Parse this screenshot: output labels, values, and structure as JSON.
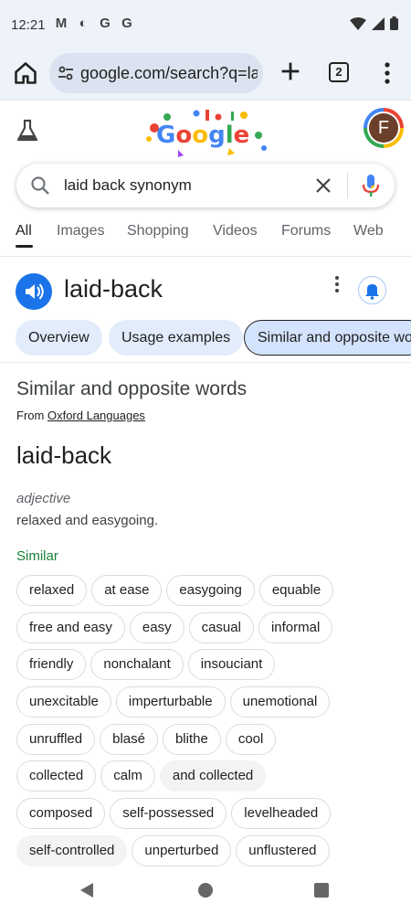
{
  "status_bar": {
    "time": "12:21",
    "notification_icons": [
      "M",
      "◐",
      "G",
      "G"
    ]
  },
  "browser": {
    "url": "google.com/search?q=la",
    "tab_count": "2"
  },
  "avatar": {
    "letter": "F"
  },
  "search": {
    "query": "laid back synonym"
  },
  "tabs": [
    "All",
    "Images",
    "Shopping",
    "Videos",
    "Forums",
    "Web"
  ],
  "dictionary": {
    "headword": "laid-back",
    "chips": [
      "Overview",
      "Usage examples",
      "Similar and opposite wo"
    ],
    "section_title": "Similar and opposite words",
    "source_prefix": "From",
    "source_link": "Oxford Languages",
    "entry_word": "laid-back",
    "part_of_speech": "adjective",
    "definition": "relaxed and easygoing.",
    "similar_label": "Similar",
    "synonym_rows": [
      [
        "relaxed",
        "at ease",
        "easygoing",
        "equable"
      ],
      [
        "free and easy",
        "easy",
        "casual",
        "informal"
      ],
      [
        "friendly",
        "nonchalant",
        "insouciant"
      ],
      [
        "unexcitable",
        "imperturbable",
        "unemotional"
      ],
      [
        "unruffled",
        "blasé",
        "blithe",
        "cool"
      ],
      [
        "collected",
        "calm",
        "and collected"
      ],
      [
        "composed",
        "self-possessed",
        "levelheaded"
      ],
      [
        "self-controlled",
        "unperturbed",
        "unflustered"
      ]
    ],
    "filled_synonyms": [
      "and collected",
      "self-controlled"
    ]
  },
  "colors": {
    "accent_blue": "#1a73e8",
    "similar_green": "#188038",
    "chip_bg": "#e3ecfb"
  }
}
